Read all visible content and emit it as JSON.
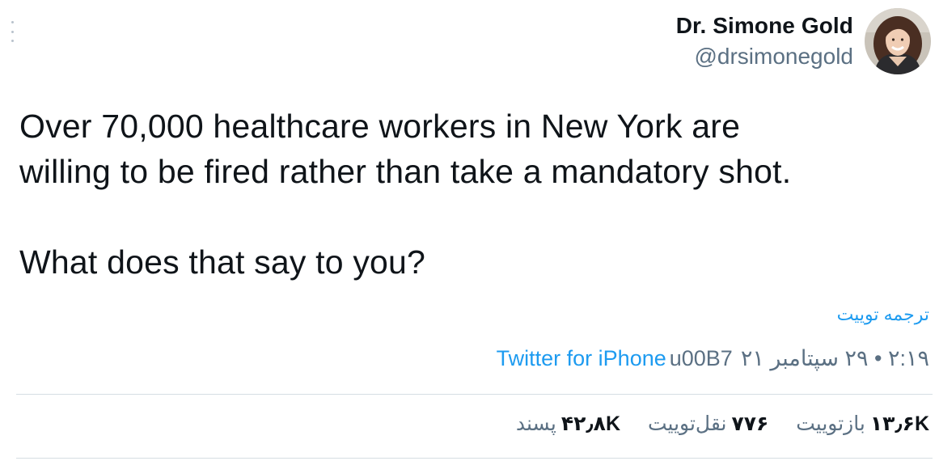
{
  "author": {
    "display_name": "Dr. Simone Gold",
    "handle": "@drsimonegold"
  },
  "tweet": {
    "text": "Over 70,000 healthcare workers in New York are\nwilling to be fired rather than take a mandatory shot.\n\nWhat does that say to you?",
    "translate_label": "ترجمه توییت"
  },
  "meta": {
    "time_date": "۲:۱۹ • ۲۹ سپتامبر ۲۱",
    "separator": "u00B7",
    "source": "Twitter for iPhone"
  },
  "stats": {
    "retweets": {
      "count": "۱۳٫۶K",
      "label": "بازتوییت"
    },
    "quotes": {
      "count": "۷۷۶",
      "label": "نقل‌توییت"
    },
    "likes": {
      "count": "۴۲٫۸K",
      "label": "پسند"
    }
  },
  "colors": {
    "link": "#1d9bf0",
    "secondary_text": "#5b7083",
    "primary_text": "#0f1419"
  },
  "icons": {
    "more": "vertical-ellipsis-icon"
  }
}
